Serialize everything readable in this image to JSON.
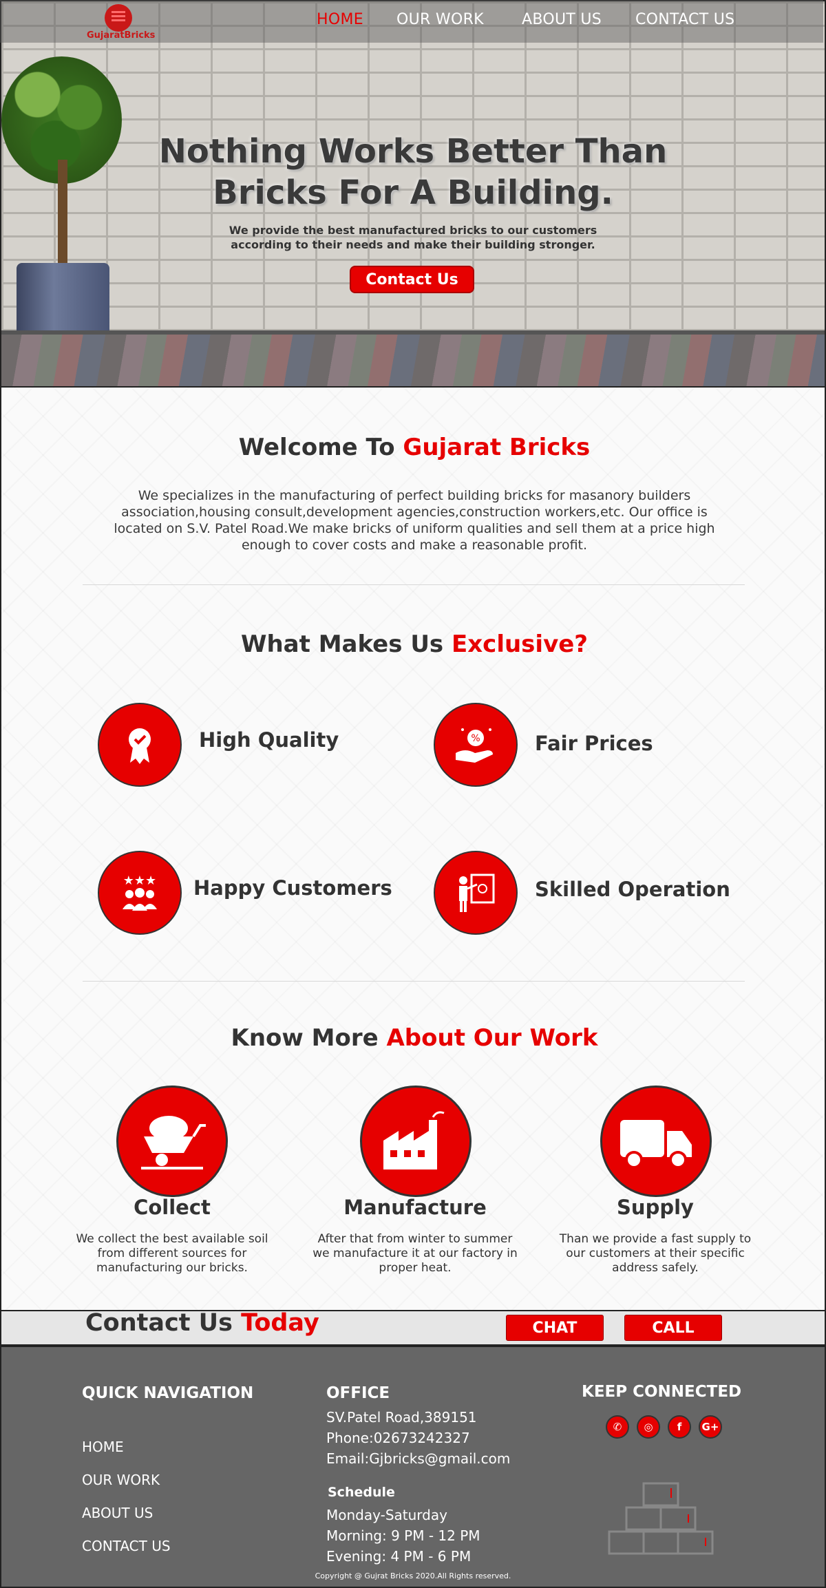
{
  "brand": {
    "logo_text": "GujaratBricks"
  },
  "nav": {
    "items": [
      "HOME",
      "OUR WORK",
      "ABOUT US",
      "CONTACT US"
    ],
    "active": "HOME"
  },
  "hero": {
    "title_line1": "Nothing Works Better Than",
    "title_line2": "Bricks For A Building.",
    "subtitle_line1": "We provide the best manufactured bricks to our customers",
    "subtitle_line2": "according to their needs and make their building stronger.",
    "cta": "Contact Us"
  },
  "welcome": {
    "heading_plain": "Welcome To ",
    "heading_accent": "Gujarat Bricks",
    "paragraph": "We specializes in the manufacturing of perfect building bricks for masanory builders association,housing consult,development agencies,construction workers,etc. Our office is located on S.V. Patel Road.We make bricks of uniform qualities and sell them at a price high enough to cover costs and make a reasonable profit."
  },
  "exclusive": {
    "heading_plain": "What Makes Us ",
    "heading_accent": "Exclusive?",
    "features": [
      {
        "label": "High Quality",
        "icon": "quality-badge-icon"
      },
      {
        "label": "Fair Prices",
        "icon": "price-hand-icon"
      },
      {
        "label": "Happy Customers",
        "icon": "customers-icon"
      },
      {
        "label": "Skilled Operation",
        "icon": "presentation-icon"
      }
    ]
  },
  "work": {
    "heading_plain": "Know More ",
    "heading_accent": "About Our Work",
    "items": [
      {
        "title": "Collect",
        "icon": "wheelbarrow-icon",
        "desc": "We collect the best available soil from different sources for manufacturing our bricks."
      },
      {
        "title": "Manufacture",
        "icon": "factory-icon",
        "desc": "After that from winter to summer we manufacture it at our factory in proper heat."
      },
      {
        "title": "Supply",
        "icon": "truck-icon",
        "desc": "Than we provide a fast supply to our customers at their specific address safely."
      }
    ]
  },
  "contact_bar": {
    "title_plain": "Contact Us ",
    "title_accent": "Today",
    "chat": "CHAT",
    "call": "CALL"
  },
  "footer": {
    "quick_nav_title": "QUICK NAVIGATION",
    "quick_nav": [
      "HOME",
      "OUR WORK",
      "ABOUT US",
      "CONTACT US"
    ],
    "office_title": "OFFICE",
    "office_lines": [
      "SV.Patel Road,389151",
      "Phone:02673242327",
      "Email:Gjbricks@gmail.com"
    ],
    "schedule_title": "Schedule",
    "schedule_lines": [
      "Monday-Saturday",
      "Morning: 9 PM - 12 PM",
      "Evening: 4 PM - 6 PM"
    ],
    "connect_title": "KEEP CONNECTED",
    "social": [
      {
        "name": "whatsapp-icon",
        "glyph": "✆"
      },
      {
        "name": "instagram-icon",
        "glyph": "◎"
      },
      {
        "name": "facebook-icon",
        "glyph": "f"
      },
      {
        "name": "google-plus-icon",
        "glyph": "G+"
      }
    ],
    "copyright": "Copyright @ Gujrat Bricks 2020.All Rights reserved."
  },
  "colors": {
    "accent": "#e60000",
    "dark": "#333333",
    "footer_bg": "#666666"
  }
}
